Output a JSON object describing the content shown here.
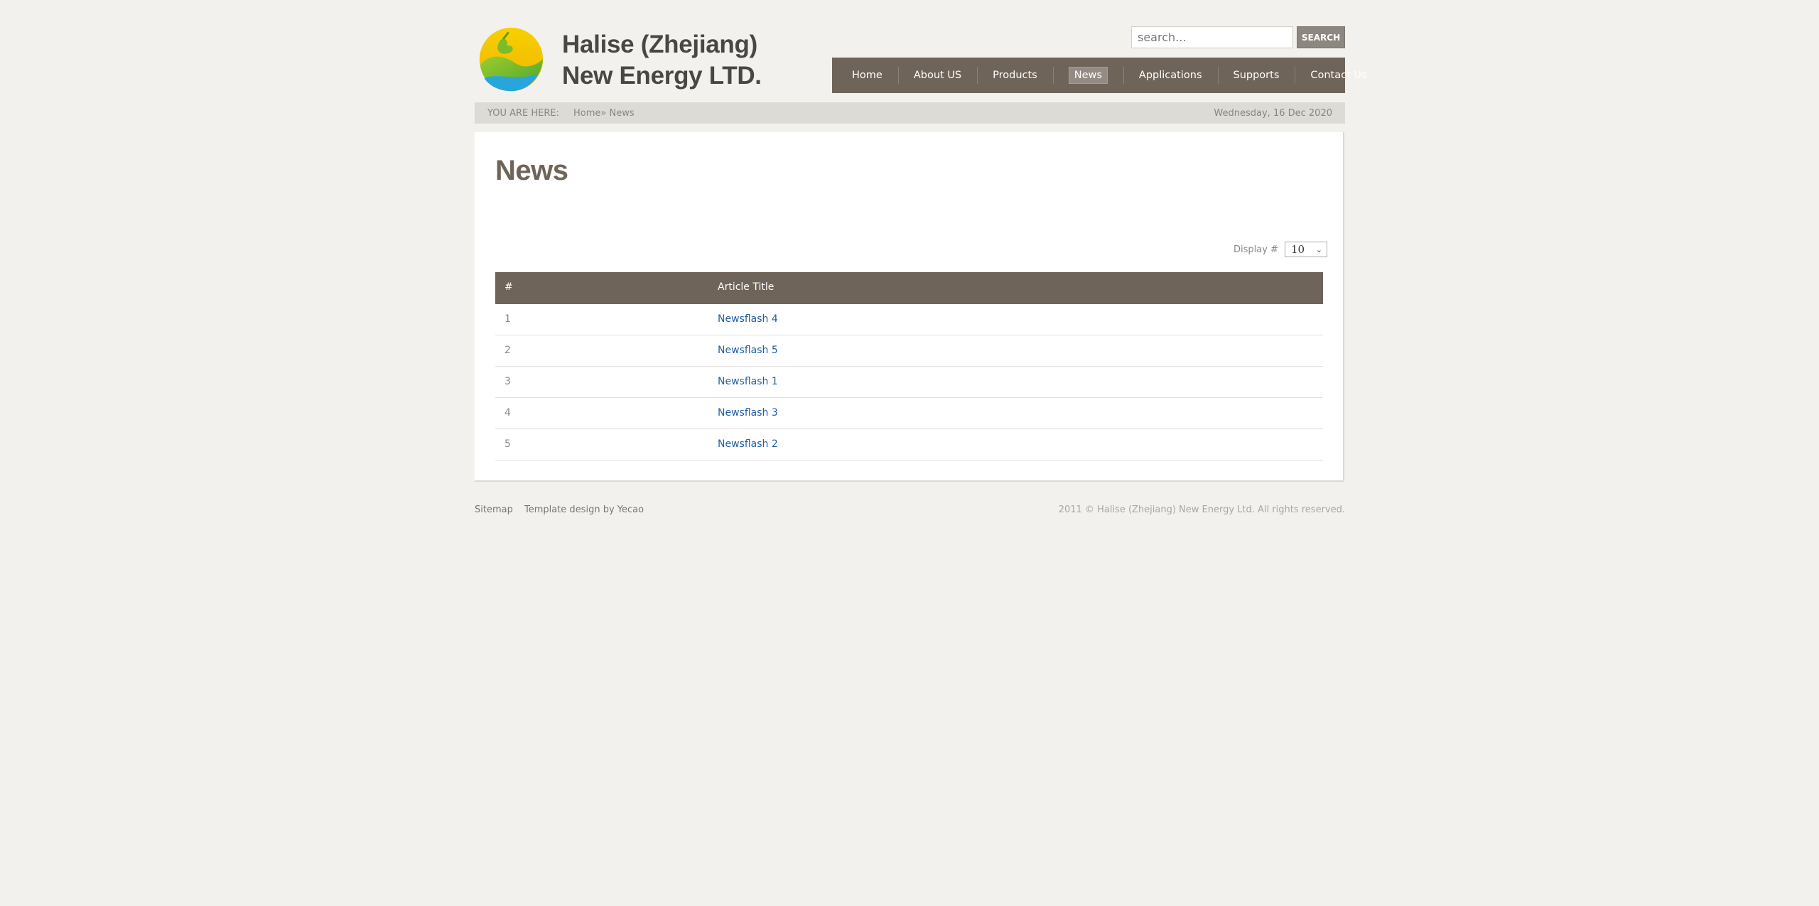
{
  "header": {
    "brand_line1": "Halise (Zhejiang)",
    "brand_line2": "New Energy LTD.",
    "logo_icon": "leaf-globe-logo",
    "search_placeholder": "search...",
    "search_button": "SEARCH"
  },
  "nav": {
    "items": [
      {
        "label": "Home",
        "active": false
      },
      {
        "label": "About US",
        "active": false
      },
      {
        "label": "Products",
        "active": false
      },
      {
        "label": "News",
        "active": true
      },
      {
        "label": "Applications",
        "active": false
      },
      {
        "label": "Supports",
        "active": false
      },
      {
        "label": "Contact Us",
        "active": false
      }
    ]
  },
  "breadcrumb": {
    "label": "YOU ARE HERE:",
    "home": "Home",
    "separator": "»",
    "current": "News",
    "date": "Wednesday, 16 Dec 2020"
  },
  "main": {
    "title": "News",
    "display_label": "Display #",
    "display_value": "10",
    "table": {
      "headers": [
        "#",
        "Article Title"
      ],
      "rows": [
        {
          "num": "1",
          "title": "Newsflash 4"
        },
        {
          "num": "2",
          "title": "Newsflash 5"
        },
        {
          "num": "3",
          "title": "Newsflash 1"
        },
        {
          "num": "4",
          "title": "Newsflash 3"
        },
        {
          "num": "5",
          "title": "Newsflash 2"
        }
      ]
    }
  },
  "footer": {
    "sitemap": "Sitemap",
    "template_credit": "Template design by Yecao",
    "copyright": "2011 © Halise (Zhejiang) New Energy Ltd. All rights reserved."
  },
  "colors": {
    "nav_bg": "#6f6459",
    "link": "#1d5fa6",
    "page_bg": "#f2f1ee"
  }
}
